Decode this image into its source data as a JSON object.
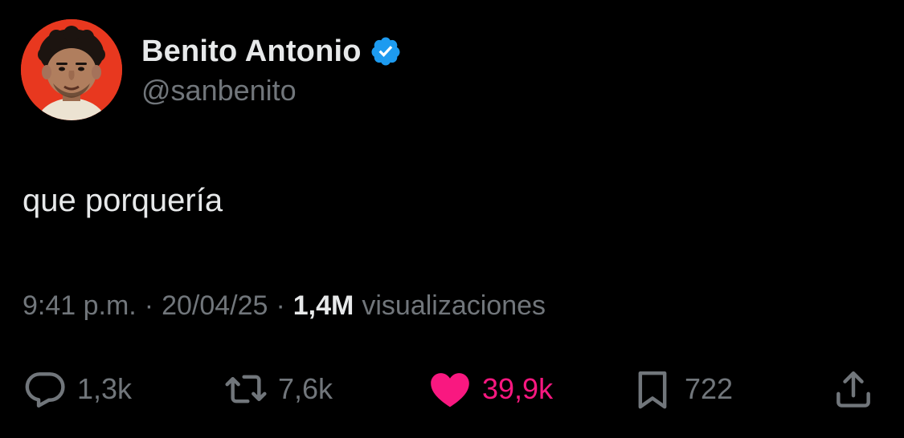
{
  "user": {
    "display_name": "Benito Antonio",
    "handle": "@sanbenito",
    "verified": true,
    "avatar_bg": "#e8381f"
  },
  "tweet": {
    "text": "que porquería"
  },
  "meta": {
    "time": "9:41 p.m.",
    "separator": "·",
    "date": "20/04/25",
    "views_count": "1,4M",
    "views_label": "visualizaciones"
  },
  "actions": {
    "reply": {
      "icon": "reply-icon",
      "count": "1,3k"
    },
    "retweet": {
      "icon": "retweet-icon",
      "count": "7,6k"
    },
    "like": {
      "icon": "heart-icon",
      "count": "39,9k",
      "color": "#f91880",
      "liked": true
    },
    "bookmark": {
      "icon": "bookmark-icon",
      "count": "722"
    },
    "share": {
      "icon": "share-icon"
    }
  },
  "colors": {
    "background": "#000000",
    "primary_text": "#e7e9ea",
    "secondary_text": "#71767b",
    "verified_blue": "#1d9bf0",
    "like_pink": "#f91880"
  }
}
